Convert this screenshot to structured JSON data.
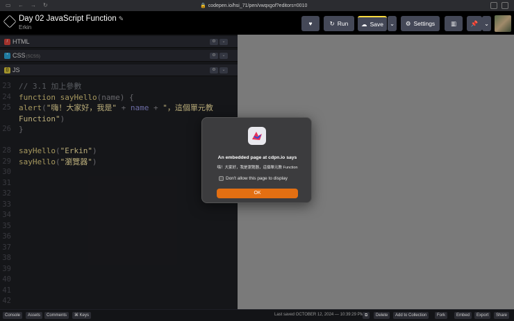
{
  "browser": {
    "url": "codepen.io/hsi_71/pen/vwqxgof?editors=0010"
  },
  "header": {
    "title": "Day 02 JavaScript Function",
    "author": "Erkin",
    "run_label": "Run",
    "save_label": "Save",
    "settings_label": "Settings"
  },
  "panels": {
    "html": {
      "name": "HTML"
    },
    "css": {
      "name": "CSS",
      "sub": "(SCSS)"
    },
    "js": {
      "name": "JS"
    }
  },
  "gutter": [
    "23",
    "24",
    "25",
    "",
    "26",
    "",
    "28",
    "29",
    "30",
    "31",
    "32",
    "33",
    "34",
    "35",
    "36",
    "37",
    "38",
    "39",
    "40",
    "41",
    "42"
  ],
  "code": {
    "l1": "// 3.1 加上參數",
    "l2_kw": "function",
    "l2_fn": "sayHello",
    "l2_p1": "(",
    "l2_arg": "name",
    "l2_p2": ") {",
    "l3_fn": "alert",
    "l3_p1": "(",
    "l3_s1": "\"嗨！大家好，我是\"",
    "l3_op1": " + ",
    "l3_id": "name",
    "l3_op2": " + ",
    "l3_s2": "\"，這個單元教",
    "l4_s": "Function\"",
    "l4_p": ")",
    "l5": "}",
    "l7_fn": "sayHello",
    "l7_p1": "(",
    "l7_s": "\"Erkin\"",
    "l7_p2": ")",
    "l8_fn": "sayHello",
    "l8_p1": "(",
    "l8_s": "\"瀏覽器\"",
    "l8_p2": ")"
  },
  "dialog": {
    "title": "An embedded page at cdpn.io says",
    "message": "嗨！大家好，我是瀏覽器，這個單元教 Function",
    "checkbox_label": "Don't allow this page to display",
    "ok_label": "OK"
  },
  "footer": {
    "console": "Console",
    "assets": "Assets",
    "comments": "Comments",
    "keys": "⌘ Keys",
    "saved": "Last saved OCTOBER 12, 2024 — 10:39:29 PM",
    "delete": "Delete",
    "collection": "Add to Collection",
    "fork": "Fork",
    "embed": "Embed",
    "export": "Export",
    "share": "Share"
  },
  "colors": {
    "accent": "#e36f12",
    "save_marker": "#ffdd40",
    "topbar": "#000000"
  }
}
